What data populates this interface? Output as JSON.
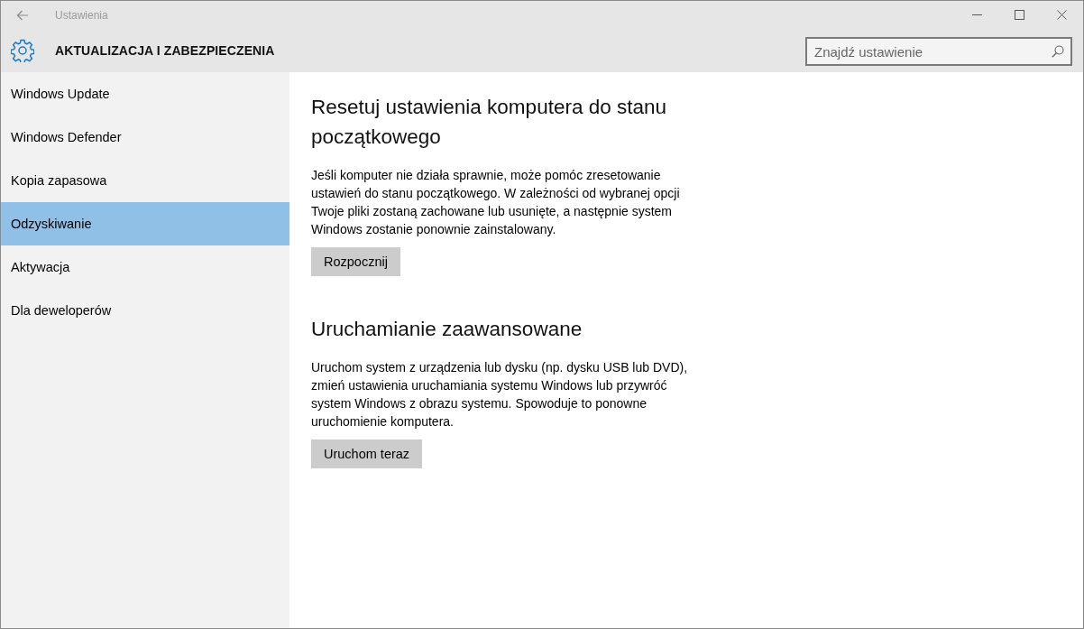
{
  "window": {
    "title": "Ustawienia"
  },
  "header": {
    "title": "AKTUALIZACJA I ZABEZPIECZENIA",
    "search": {
      "placeholder": "Znajdź ustawienie"
    }
  },
  "sidebar": {
    "items": [
      {
        "label": "Windows Update",
        "selected": false
      },
      {
        "label": "Windows Defender",
        "selected": false
      },
      {
        "label": "Kopia zapasowa",
        "selected": false
      },
      {
        "label": "Odzyskiwanie",
        "selected": true
      },
      {
        "label": "Aktywacja",
        "selected": false
      },
      {
        "label": "Dla deweloperów",
        "selected": false
      }
    ]
  },
  "sections": [
    {
      "heading": "Resetuj ustawienia komputera do stanu początkowego",
      "text": "Jeśli komputer nie działa sprawnie, może pomóc zresetowanie ustawień do stanu początkowego. W zależności od wybranej opcji Twoje pliki zostaną zachowane lub usunięte, a następnie system Windows zostanie ponownie zainstalowany.",
      "button": "Rozpocznij"
    },
    {
      "heading": "Uruchamianie zaawansowane",
      "text": "Uruchom system z urządzenia lub dysku (np. dysku USB lub DVD), zmień ustawienia uruchamiania systemu Windows lub przywróć system Windows z obrazu systemu. Spowoduje to ponowne uruchomienie komputera.",
      "button": "Uruchom teraz"
    }
  ]
}
